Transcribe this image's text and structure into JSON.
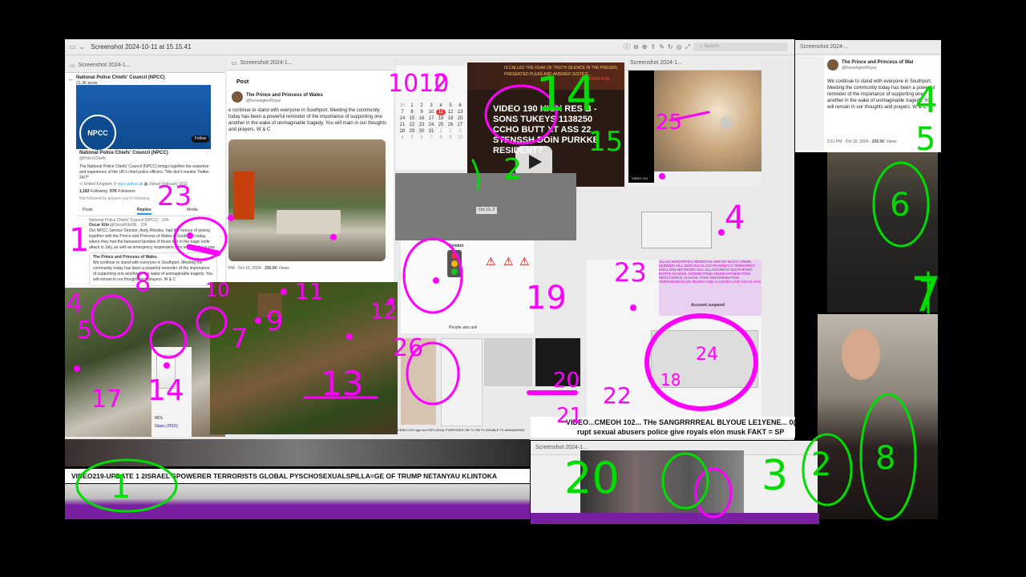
{
  "main_window": {
    "title": "Screenshot 2024-10-11 at 15.15.41",
    "search_placeholder": "Search"
  },
  "right_window": {
    "title": "Screenshot 2024-..."
  },
  "sub_window_title": "Screenshot 2024-1...",
  "npcc": {
    "header_title": "National Police Chiefs' Council (NPCC)",
    "header_posts": "21.3K posts",
    "logo_text": "NPCC",
    "follow_label": "Follow",
    "name": "National Police Chiefs' Council (NPCC)",
    "handle": "@PoliceChiefs",
    "bio": "The National Police Chiefs' Council (NPCC) brings together the expertise and experience of the UK's chief police officers. *We don't monitor Twitter 24/7*",
    "location": "United Kingdom",
    "website": "npcc.police.uk",
    "joined": "Joined February 2011",
    "following_count": "1,183",
    "following_label": "Following",
    "followers_count": "57K",
    "followers_label": "Followers",
    "not_followed": "Not followed by anyone you're following",
    "tab_posts": "Posts",
    "tab_replies": "Replies",
    "tab_media": "Media",
    "reply_context": "National Police Chiefs' Council (NPCC) · 10h",
    "reply_author": "Oscar Kilo",
    "reply_handle": "@OscarKiloUK · 10h",
    "reply_text": "Our NPCC Service Director, Andy Rhodes, had the honour of joining together with the Prince and Princess of Wales in Southport today, where they met the bereaved families of those lost in the tragic knife attack in July, as well as emergency responders who were at the scene",
    "quote_author": "The Prince and Princess of Wales",
    "quote_handle": "@KensingtonRoyal · 20h",
    "quote_text": "We continue to stand with everyone in Southport. Meeting the community today has been a powerful reminder of the importance of supporting one another in the wake of unimaginable tragedy. You will remain in our thoughts and prayers. W & C"
  },
  "post_window": {
    "header": "Post",
    "author": "The Prince and Princess of Wales",
    "handle": "@KensingtonRoyal",
    "text": "e continue to stand with everyone in Southport. Meeting the community today has been a powerful reminder of the importance of supporting one another in the wake of unimaginable tragedy. You will main in our thoughts and prayers. W & C",
    "meta_time": "PM · Oct 10, 2024 ·",
    "meta_views": "206.5K",
    "meta_views_label": "Views"
  },
  "calendar": {
    "rows": [
      [
        "30",
        "1",
        "2",
        "3",
        "4",
        "5",
        "6"
      ],
      [
        "7",
        "8",
        "9",
        "10",
        "11",
        "12",
        "13"
      ],
      [
        "14",
        "15",
        "16",
        "17",
        "18",
        "19",
        "20"
      ],
      [
        "21",
        "22",
        "23",
        "24",
        "25",
        "26",
        "27"
      ],
      [
        "28",
        "29",
        "30",
        "31",
        "1",
        "2",
        "3"
      ],
      [
        "4",
        "5",
        "6",
        "7",
        "8",
        "9",
        "10"
      ]
    ],
    "today": "11"
  },
  "video_card": {
    "line1": "VIDEO 190 HIGH RES B -",
    "line2": "SONS TUKEYS 1138250",
    "line3": "CCHO BUTT XT ASS 22",
    "line4": "STENSSH DOiN PURKKE",
    "line5": "RESIDENT?",
    "top_strip_1": "IS CALLED THE FEAR OF TRUTH SILENCE IN THE PRESEN",
    "top_strip_2": "PRESENTED PLEAS AND ANSWER JUSTICE...",
    "top_strip_3": "STANDING FOR"
  },
  "video101": {
    "label": "VIDEO 101"
  },
  "date_stub": "Oct 10, 2",
  "traffic_panel": {
    "heading": "Symbol",
    "footer": "People also ask"
  },
  "pink_text_panel": {
    "text": "ALLAH WITH ROYAL BENEFITS ADD SO MUCH CRIME MURDER KILL SERVICE FLATS PHARMACY TERRORIST ENGLAND NETWORK KILL ALL SECRETS SOUTHPORT DARTS SCHOOL INTIMIDATION ABUSE INTIMIDATION NEGLIGENCE SCHOOL FAKE DISCRIMINATION TERRORISM ELON MUSKS AND ALLEGRA LIAR ASS IS HAS",
    "suspended": "Account suspend"
  },
  "right_tweet": {
    "author": "The Prince and Princess of Wal",
    "handle": "@KensingtonRoyal",
    "text": "We continue to stand with everyone in Southport. Meeting the community today has been a powerful reminder of the importance of supporting one another in the wake of unimaginable tragedy. You will remain in our thoughts and prayers. W & C",
    "meta": "5:11 PM · Oct 10, 2024 ·",
    "views": "206.5K",
    "views_label": "Views"
  },
  "shop": {
    "title": "Glass (2016)",
    "label": "MDL"
  },
  "misc_caption": "VIDEO 219 high res FOR LEGAL PURPOSES ON TV ON TV DOUBLE TV AAAAAHHHH",
  "tickers": {
    "bottom": "VIDEO219-UPDATE 1 2ISRAEL'SPOWERER TERRORISTS GLOBAL PYSCHOSEXUALSPILLA=GE OF TRUMP NETANYAU KLINTOKA",
    "mid1": "VIDEO...CMEOH 102... THe SANGRRRREAL BLYOUE LE1YENE... 0(",
    "mid2": "rupt sexual abusers police give royals elon musk FAKT = SP"
  },
  "annotations": {
    "pink": [
      "1010",
      "2",
      "23",
      "1",
      "4",
      "5",
      "8",
      "10",
      "7",
      "9",
      "11",
      "12",
      "13",
      "14",
      "17",
      "19",
      "20",
      "21",
      "22",
      "23",
      "24",
      "25",
      "26",
      "4",
      "18"
    ],
    "green": [
      "14",
      "15",
      "2",
      "4",
      "5",
      "6",
      "7",
      "8",
      "1",
      "20",
      "2",
      "3"
    ]
  },
  "colors": {
    "magenta": "#ff00ff",
    "green": "#00dd00",
    "purple": "#7a1fa2"
  }
}
